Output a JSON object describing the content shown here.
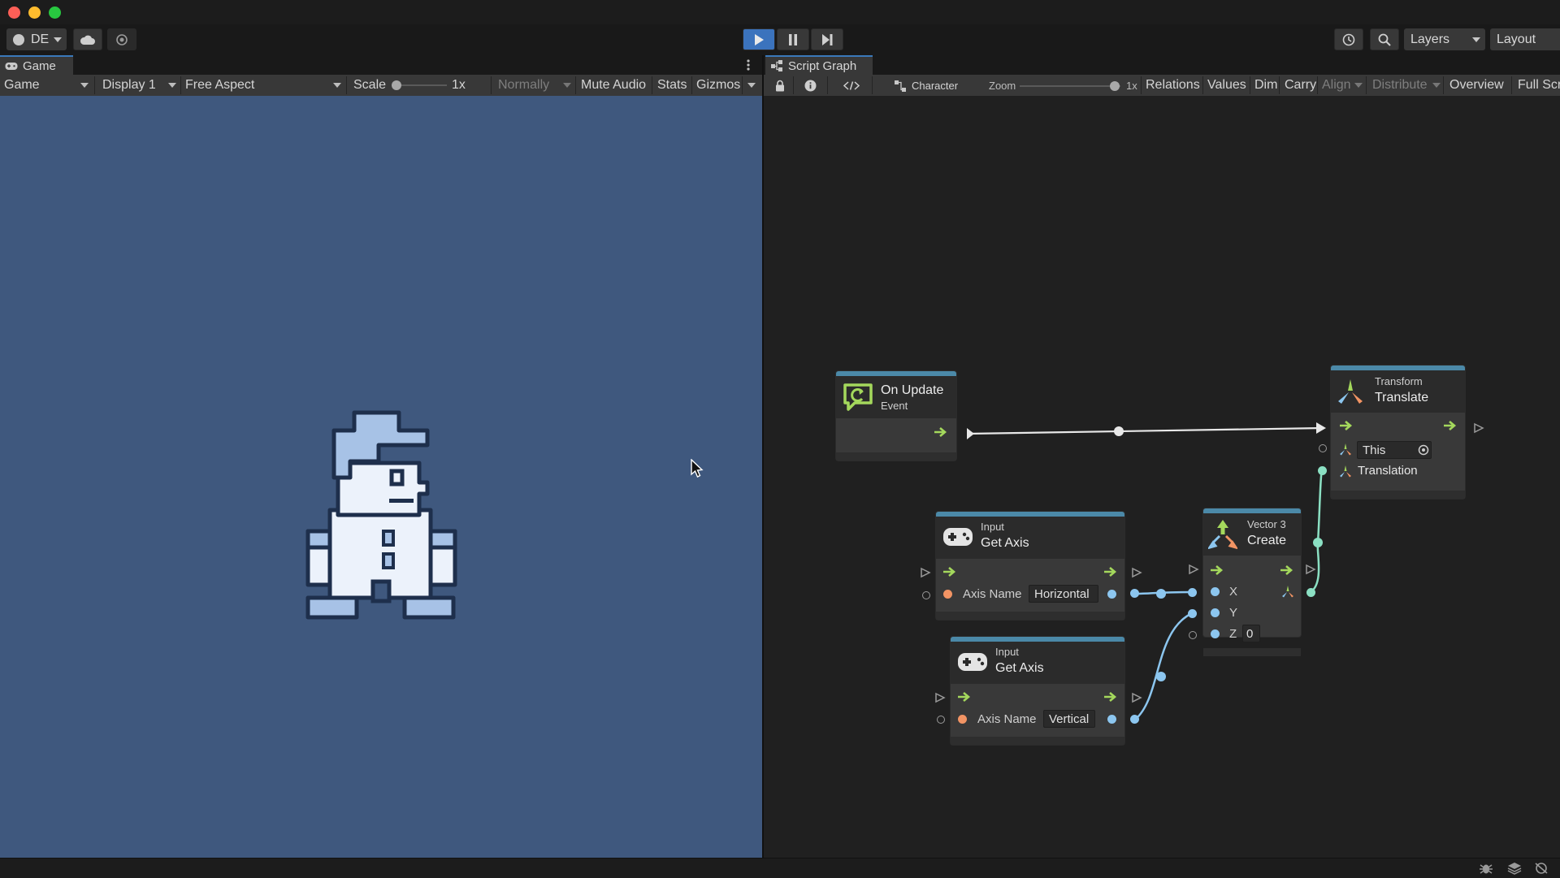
{
  "window": {
    "light_colors": [
      "#fd5f57",
      "#febc2e",
      "#28c840"
    ]
  },
  "toolbar": {
    "account_label": "DE",
    "layers_label": "Layers",
    "layout_label": "Layout",
    "play_color": "#3b73bd"
  },
  "game_panel": {
    "tab_label": "Game",
    "mode_dropdown": "Game",
    "display_dropdown": "Display 1",
    "aspect_dropdown": "Free Aspect",
    "scale_label": "Scale",
    "scale_value": "1x",
    "play_focus_dropdown": "Normally",
    "mute_audio": "Mute Audio",
    "stats": "Stats",
    "gizmos": "Gizmos",
    "background_color": "#3f587e"
  },
  "graph_panel": {
    "tab_label": "Script Graph",
    "breadcrumb": "Character",
    "zoom_label": "Zoom",
    "zoom_value": "1x",
    "buttons": {
      "relations": "Relations",
      "values": "Values",
      "dim": "Dim",
      "carry": "Carry",
      "align": "Align",
      "distribute": "Distribute",
      "overview": "Overview",
      "fullscreen": "Full Scre"
    }
  },
  "nodes": {
    "on_update": {
      "title": "On Update",
      "subtitle": "Event"
    },
    "translate": {
      "category": "Transform",
      "title": "Translate",
      "target_value": "This",
      "port_translation": "Translation"
    },
    "get_axis_h": {
      "category": "Input",
      "title": "Get Axis",
      "port_label": "Axis Name",
      "value": "Horizontal"
    },
    "get_axis_v": {
      "category": "Input",
      "title": "Get Axis",
      "port_label": "Axis Name",
      "value": "Vertical"
    },
    "vector3": {
      "category": "Vector 3",
      "title": "Create",
      "port_x": "X",
      "port_y": "Y",
      "port_z": "Z",
      "z_value": "0"
    }
  }
}
